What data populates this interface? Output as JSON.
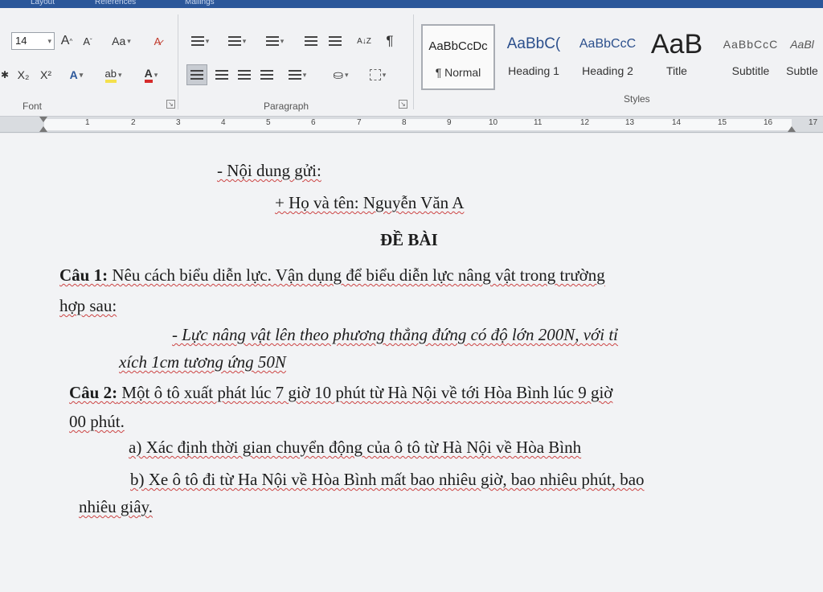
{
  "ribbon": {
    "top_tabs": [
      "Layout",
      "References",
      "Mailings"
    ],
    "font": {
      "size": "14",
      "grow_label": "A",
      "shrink_label": "A",
      "case_label": "Aa",
      "subscript_label": "X₂",
      "superscript_label": "X²",
      "text_effects_label": "A",
      "highlight_label": "ab",
      "font_color_label": "A",
      "group_label": "Font"
    },
    "paragraph": {
      "sort_label": "A↓Z",
      "pilcrow_label": "¶",
      "group_label": "Paragraph"
    },
    "styles": {
      "group_label": "Styles",
      "items": [
        {
          "sample": "AaBbCcDc",
          "name": "¶ Normal"
        },
        {
          "sample": "AaBbC(",
          "name": "Heading 1"
        },
        {
          "sample": "AaBbCcC",
          "name": "Heading 2"
        },
        {
          "sample": "AaB",
          "name": "Title"
        },
        {
          "sample": "AaBbCcC",
          "name": "Subtitle"
        },
        {
          "sample": "AaBl",
          "name": "Subtle"
        }
      ]
    }
  },
  "ruler": {
    "ticks": [
      "1",
      "2",
      "3",
      "4",
      "5",
      "6",
      "7",
      "8",
      "9",
      "10",
      "11",
      "12",
      "13",
      "14",
      "15",
      "16",
      "17"
    ]
  },
  "document": {
    "line1": "- Nội dung gửi:",
    "line2": "+ Họ và tên: Nguyễn Văn A",
    "heading": "ĐỀ BÀI",
    "q1_label": "Câu 1:",
    "q1_text": " Nêu cách biểu diễn lực. Vận dụng để biểu diễn lực nâng vật trong trường",
    "q1_cont": "hợp sau:",
    "q1_item": "- Lực nâng vật lên theo phương thẳng đứng có độ lớn 200N, với tỉ",
    "q1_item_cont": "xích 1cm tương ứng 50N",
    "q2_label": "Câu 2:",
    "q2_text": " Một ô tô xuất phát lúc 7 giờ 10 phút từ Hà Nội về tới Hòa Bình lúc 9 giờ",
    "q2_cont": "00 phút.",
    "q2_a": "a) Xác định thời gian chuyển động của ô tô từ Hà Nội về Hòa Bình",
    "q2_b": "b) Xe ô tô đi từ Ha Nội về Hòa Bình mất bao nhiêu giờ, bao nhiêu phút, bao",
    "q2_b_cont": "nhiêu giây."
  }
}
